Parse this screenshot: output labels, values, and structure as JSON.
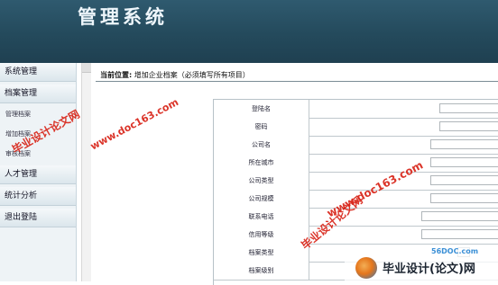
{
  "header": {
    "title": "管理系统"
  },
  "sidebar": {
    "items": [
      {
        "label": "系统管理"
      },
      {
        "label": "档案管理"
      },
      {
        "label": "人才管理"
      },
      {
        "label": "统计分析"
      },
      {
        "label": "退出登陆"
      }
    ],
    "subitems": [
      {
        "label": "管理档案"
      },
      {
        "label": "增加档案"
      },
      {
        "label": "审核档案"
      }
    ]
  },
  "breadcrumb": {
    "label": "当前位置:",
    "path": "增加企业档案（必须填写所有项目）"
  },
  "form": {
    "rows": [
      {
        "label": "登陆名"
      },
      {
        "label": "密码"
      },
      {
        "label": "公司名"
      },
      {
        "label": "所在城市"
      },
      {
        "label": "公司类型"
      },
      {
        "label": "公司规模"
      },
      {
        "label": "联系电话"
      },
      {
        "label": "信用等级"
      },
      {
        "label": "档案类型"
      },
      {
        "label": "档案级别"
      }
    ]
  },
  "watermarks": {
    "url": "www.doc163.com",
    "brand": "毕业设计论文网",
    "site": "56DOC.com",
    "logo_text": "毕业设计(论文)网"
  },
  "colors": {
    "header_bg": "#244a5c",
    "watermark": "#d82418"
  }
}
